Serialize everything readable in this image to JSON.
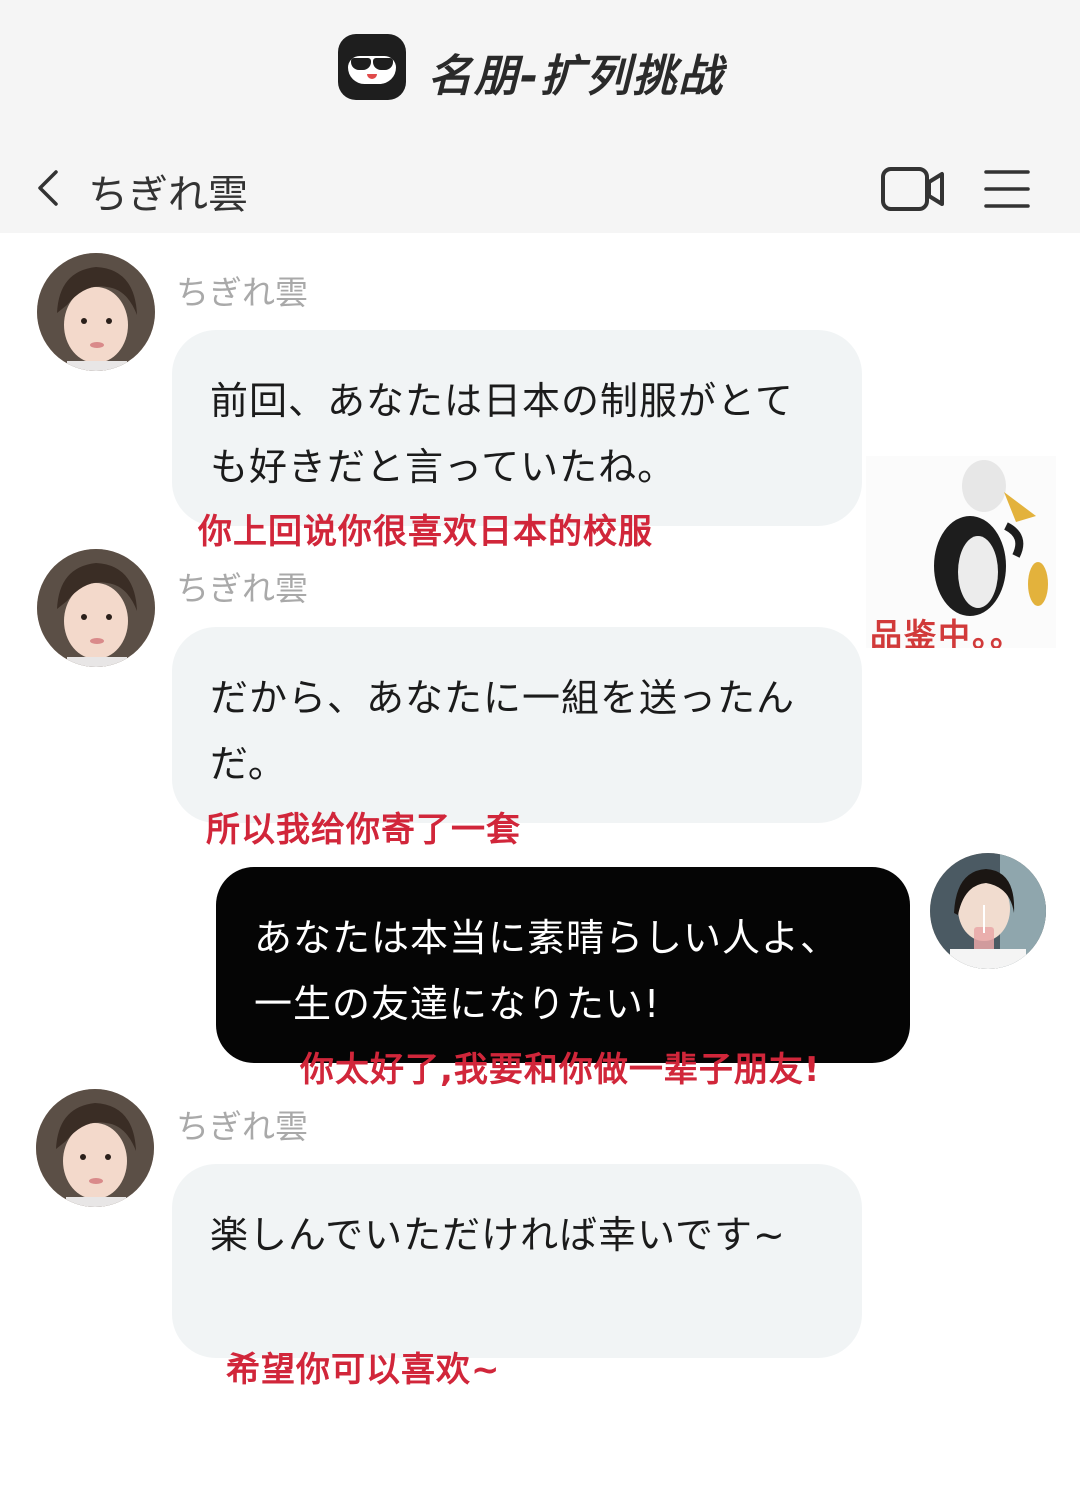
{
  "app": {
    "title": "名朋-扩列挑战"
  },
  "nav": {
    "title": "ちぎれ雲"
  },
  "messages": [
    {
      "sender": "ちぎれ雲",
      "text": "前回、あなたは日本の制服がとても好きだと言っていたね。",
      "caption": "你上回说你很喜欢日本的校服"
    },
    {
      "sender": "ちぎれ雲",
      "text": "だから、あなたに一組を送ったんだ。",
      "caption": "所以我给你寄了一套"
    },
    {
      "sender": "",
      "text": "あなたは本当に素晴らしい人よ、一生の友達になりたい!",
      "caption": "你太好了,我要和你做一辈子朋友!"
    },
    {
      "sender": "ちぎれ雲",
      "text": "楽しんでいただければ幸いです~",
      "caption": "希望你可以喜欢~"
    }
  ],
  "sticker": {
    "text": "品鉴中。。"
  },
  "colors": {
    "caption": "#d1263a",
    "bubble_in": "#f1f4f5",
    "bubble_out": "#050505",
    "header_bg": "#f5f5f5"
  },
  "icons": [
    "back-chevron-icon",
    "video-call-icon",
    "menu-icon"
  ]
}
